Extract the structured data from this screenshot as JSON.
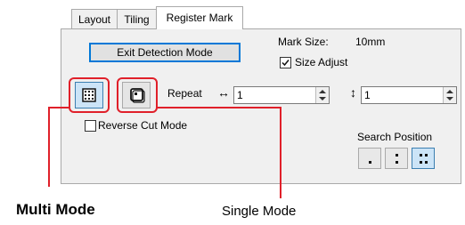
{
  "tabs": [
    {
      "label": "Layout"
    },
    {
      "label": "Tiling"
    },
    {
      "label": "Register Mark"
    }
  ],
  "exit_button_label": "Exit Detection Mode",
  "mark_size": {
    "label": "Mark Size:",
    "value": "10mm"
  },
  "size_adjust": {
    "label": "Size Adjust",
    "checked": true
  },
  "repeat": {
    "label": "Repeat",
    "horizontal_icon": "↔",
    "vertical_icon": "↕",
    "h_value": "1",
    "v_value": "1"
  },
  "reverse_cut": {
    "label": "Reverse Cut Mode",
    "checked": false
  },
  "search_position": {
    "label": "Search Position",
    "options": [
      "single-dot",
      "two-dots",
      "four-dots"
    ],
    "selected": 2
  },
  "callouts": {
    "multi_mode": "Multi Mode",
    "single_mode": "Single Mode"
  },
  "colors": {
    "accent": "#0078d7",
    "callout": "#e0202a",
    "selected_bg": "#cce4f7"
  },
  "icons": {
    "multi_mode": "multi-grid-icon",
    "single_mode": "single-square-icon"
  }
}
